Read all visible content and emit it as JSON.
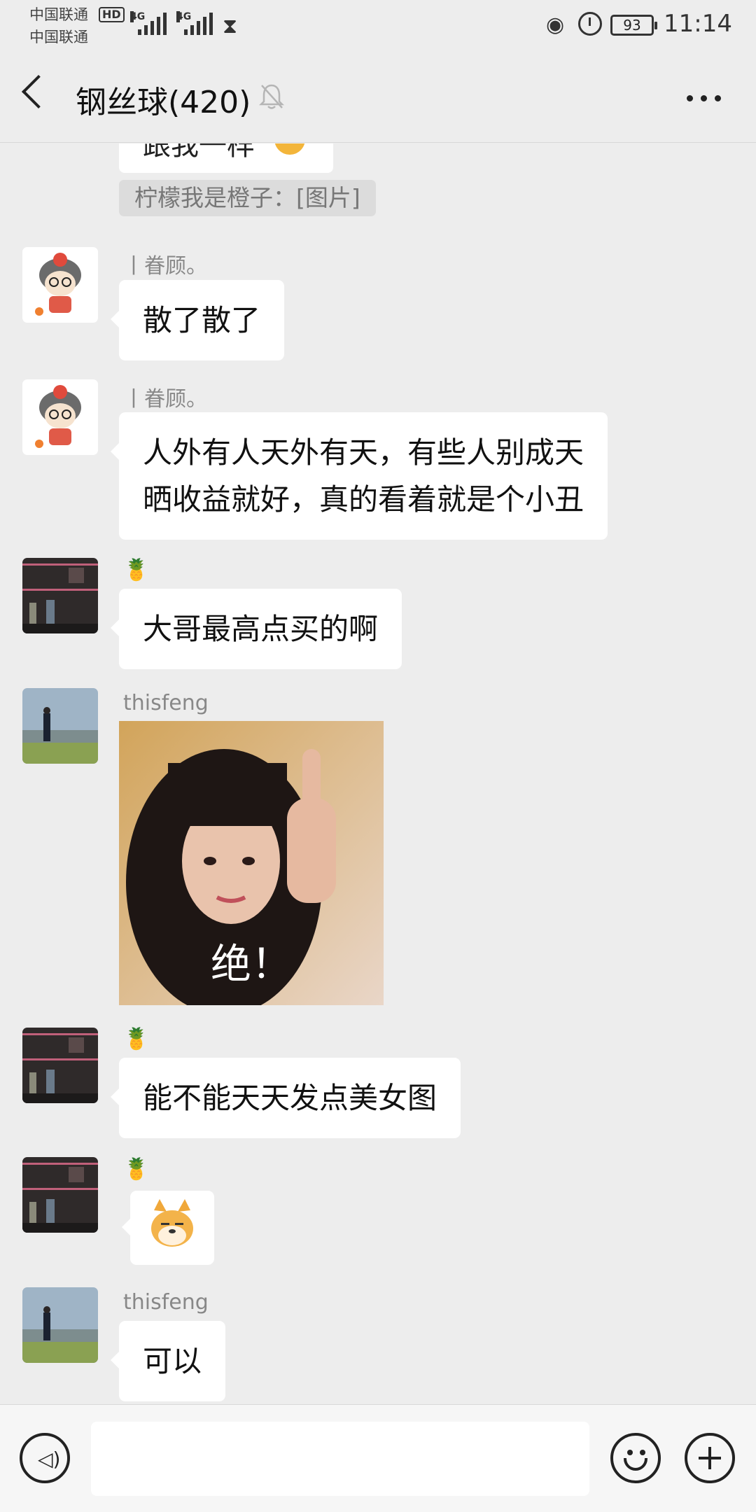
{
  "status_bar": {
    "carrier_1": "中国联通",
    "carrier_2": "中国联通",
    "hd_badge": "HD",
    "network_1": "4G",
    "network_2": "4G",
    "battery": "93",
    "time": "11:14"
  },
  "header": {
    "title": "钢丝球(420)"
  },
  "messages": {
    "partial_bubble_text": "跟我一样",
    "system_notice": "柠檬我是橙子：[图片]",
    "m1": {
      "sender": "丨眷顾。",
      "text": "散了散了"
    },
    "m2": {
      "sender": "丨眷顾。",
      "line1": "人外有人天外有天，有些人别成天",
      "line2": "晒收益就好，真的看着就是个小丑"
    },
    "m3": {
      "sender": "🍍",
      "text": "大哥最高点买的啊"
    },
    "m4": {
      "sender": "thisfeng",
      "image_caption": "绝！"
    },
    "m5": {
      "sender": "🍍",
      "text": "能不能天天发点美女图"
    },
    "m6": {
      "sender": "🍍"
    },
    "m7": {
      "sender": "thisfeng",
      "text": "可以"
    }
  },
  "icons": {
    "back": "back-arrow-icon",
    "mute": "bell-muted-icon",
    "more": "more-dots-icon",
    "voice": "voice-icon",
    "emoji": "emoji-icon",
    "plus": "plus-icon"
  }
}
